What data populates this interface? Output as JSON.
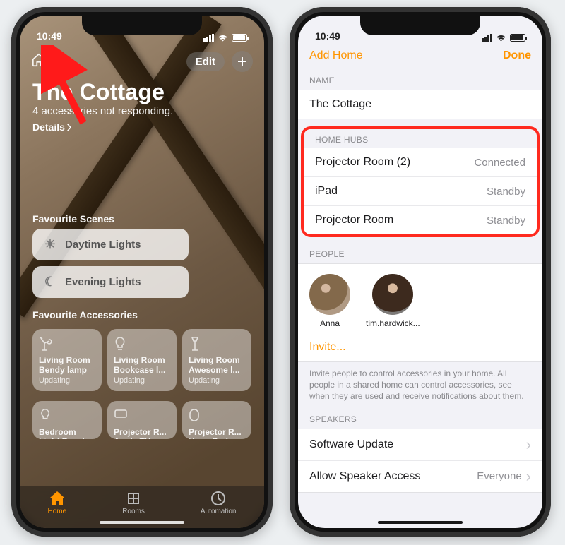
{
  "statusbar": {
    "time": "10:49"
  },
  "screen1": {
    "edit_label": "Edit",
    "title": "The Cottage",
    "subtitle": "4 accessories not responding.",
    "details_label": "Details",
    "fav_scenes_label": "Favourite Scenes",
    "scenes": [
      {
        "label": "Daytime Lights"
      },
      {
        "label": "Evening Lights"
      }
    ],
    "fav_acc_label": "Favourite Accessories",
    "accessories_row1": [
      {
        "title": "Living Room Bendy lamp",
        "status": "Updating"
      },
      {
        "title": "Living Room Bookcase l...",
        "status": "Updating"
      },
      {
        "title": "Living Room Awesome l...",
        "status": "Updating"
      }
    ],
    "accessories_row2": [
      {
        "title": "Bedroom Light Panels",
        "status": ""
      },
      {
        "title": "Projector R... Apple TV",
        "status": ""
      },
      {
        "title": "Projector R... HomePod",
        "status": ""
      }
    ],
    "tabs": {
      "home": "Home",
      "rooms": "Rooms",
      "automation": "Automation"
    }
  },
  "screen2": {
    "nav_left": "Add Home",
    "nav_right": "Done",
    "name_header": "NAME",
    "home_name": "The Cottage",
    "hubs_header": "HOME HUBS",
    "hubs": [
      {
        "name": "Projector Room (2)",
        "status": "Connected"
      },
      {
        "name": "iPad",
        "status": "Standby"
      },
      {
        "name": "Projector Room",
        "status": "Standby"
      }
    ],
    "people_header": "PEOPLE",
    "people": [
      {
        "name": "Anna"
      },
      {
        "name": "tim.hardwick..."
      }
    ],
    "invite_label": "Invite...",
    "footnote": "Invite people to control accessories in your home. All people in a shared home can control accessories, see when they are used and receive notifications about them.",
    "speakers_header": "SPEAKERS",
    "software_update_label": "Software Update",
    "speaker_access_label": "Allow Speaker Access",
    "speaker_access_value": "Everyone"
  }
}
